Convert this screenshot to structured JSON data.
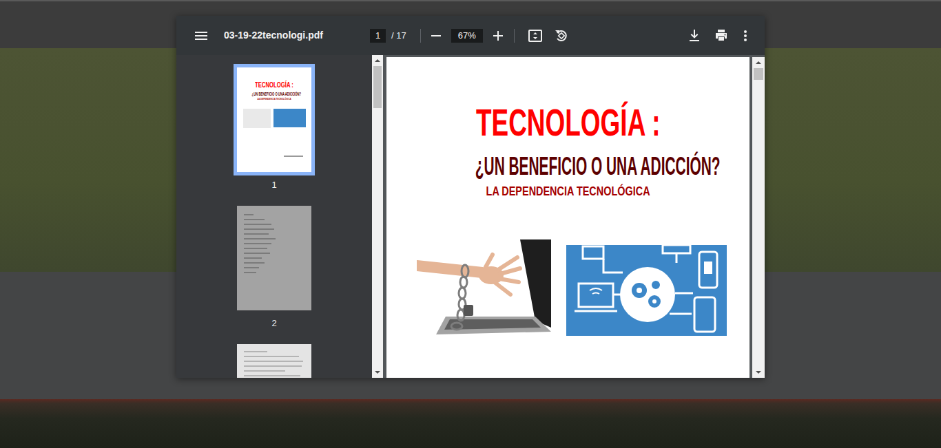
{
  "viewer": {
    "filename": "03-19-22tecnologi.pdf",
    "page_current": "1",
    "page_total": "/ 17",
    "zoom": "67%"
  },
  "thumbnails": [
    {
      "label": "1",
      "selected": true,
      "kind": "cover"
    },
    {
      "label": "2",
      "selected": false,
      "kind": "index"
    },
    {
      "selected": false,
      "kind": "text"
    }
  ],
  "document": {
    "title": "TECNOLOGÍA :",
    "subtitle": "¿UN BENEFICIO O UNA ADICCIÓN?",
    "tagline": "LA DEPENDENCIA TECNOLÓGICA"
  },
  "scrollbars": {
    "sidebar": {
      "level": 0.14
    },
    "page": {
      "level": 0.04
    }
  }
}
